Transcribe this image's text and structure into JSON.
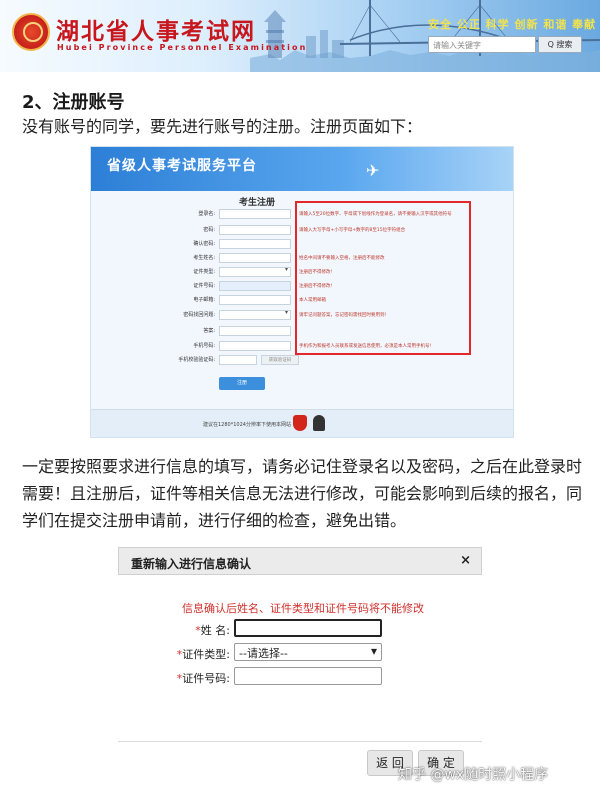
{
  "banner": {
    "site_title": "湖北省人事考试网",
    "site_subtitle": "Hubei Province Personnel Examination",
    "slogans": "安全 公正 科学 创新 和谐 奉献",
    "search_placeholder": "请输入关键字",
    "search_button": "Q 搜索",
    "seal_color": "#c5201b"
  },
  "article": {
    "heading": "2、注册账号",
    "para1": "没有账号的同学，要先进行账号的注册。注册页面如下：",
    "para2": "一定要按照要求进行信息的填写，请务必记住登录名以及密码，之后在此登录时需要！且注册后，证件等相关信息无法进行修改，可能会影响到后续的报名，同学们在提交注册申请前，进行仔细的检查，避免出错。"
  },
  "registration": {
    "platform_title": "省级人事考试服务平台",
    "form_title": "考生注册",
    "fields": [
      {
        "label": "登录名:",
        "hint": "请输入5至20位数字、字母或下划线作为登录名，请不要输入汉字或其他符号"
      },
      {
        "label": "密码:",
        "hint": "请输入大写字母+小写字母+数字的8至15位字符组合"
      },
      {
        "label": "确认密码:",
        "hint": ""
      },
      {
        "label": "考生姓名:",
        "hint": "姓名中间请不要输入空格，注册后不能修改"
      },
      {
        "label": "证件类型:",
        "hint": "注册后不得修改!"
      },
      {
        "label": "证件号码:",
        "hint": "注册后不得修改!"
      },
      {
        "label": "电子邮箱:",
        "hint": "本人常用邮箱"
      },
      {
        "label": "密码找回问题:",
        "hint": "请牢记问题答案，忘记密码需找回时要用到!"
      },
      {
        "label": "答案:",
        "hint": ""
      },
      {
        "label": "手机号码:",
        "hint": "手机作为和报考人员联系或发送信息使用，必须是本人常用手机号!"
      },
      {
        "label": "手机校验验证码:",
        "hint": ""
      }
    ],
    "verify_button": "获取验证码",
    "submit_button": "注册",
    "footer_text": "建议在1280*1024分辨率下使用本网站"
  },
  "confirm_dialog": {
    "title": "重新输入进行信息确认",
    "close_symbol": "×",
    "warning": "信息确认后姓名、证件类型和证件号码将不能修改",
    "fields": [
      {
        "label": "姓  名:",
        "value": ""
      },
      {
        "label": "证件类型:",
        "value": "--请选择--"
      },
      {
        "label": "证件号码:",
        "value": ""
      }
    ],
    "back_button": "返 回",
    "ok_button": "确 定"
  },
  "watermark": "知乎 @wx随时照小程序"
}
